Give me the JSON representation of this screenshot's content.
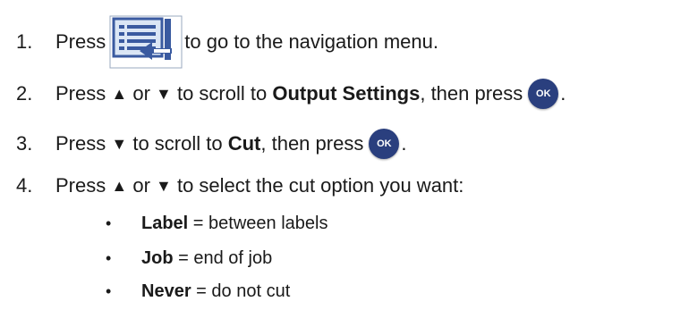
{
  "steps": [
    {
      "num": "1.",
      "pre": "Press",
      "icon": "navigation-menu-icon",
      "post": "to go to the navigation menu."
    },
    {
      "num": "2.",
      "pre": "Press",
      "up": "▲",
      "or": "or",
      "down": "▼",
      "mid": "to scroll to",
      "bold": "Output Settings",
      "after": ", then press",
      "ok": "OK",
      "end": "."
    },
    {
      "num": "3.",
      "pre": "Press",
      "down": "▼",
      "mid": "to scroll to",
      "bold": "Cut",
      "after": ", then press",
      "ok": "OK",
      "end": "."
    },
    {
      "num": "4.",
      "pre": "Press",
      "up": "▲",
      "or": "or",
      "down": "▼",
      "post": "to select the cut option you want:"
    }
  ],
  "options": [
    {
      "bullet": "•",
      "bold": "Label",
      "rest": " = between labels"
    },
    {
      "bullet": "•",
      "bold": "Job",
      "rest": " = end of job"
    },
    {
      "bullet": "•",
      "bold": "Never",
      "rest": " = do not cut"
    }
  ],
  "colors": {
    "ok_button": "#2a3f7e",
    "nav_icon_frame": "#3a5aa0",
    "nav_icon_fill": "#dbe6f5"
  }
}
